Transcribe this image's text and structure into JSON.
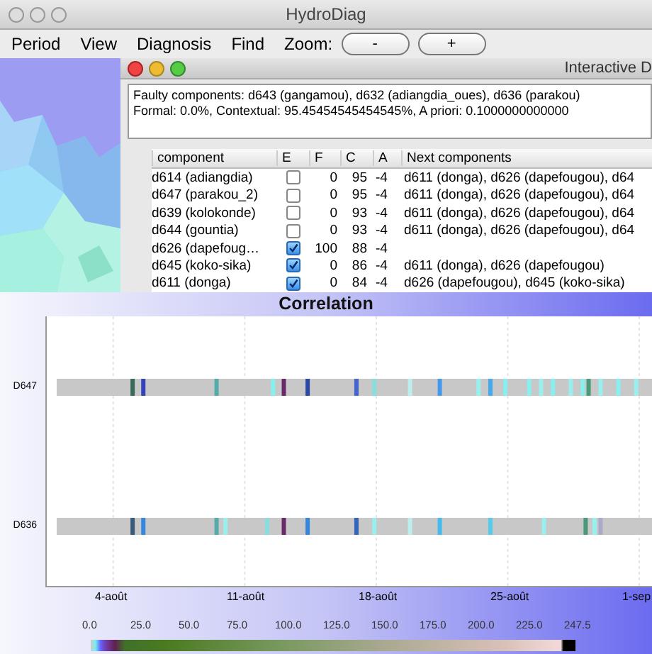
{
  "window": {
    "title": "HydroDiag"
  },
  "menu": [
    "Period",
    "View",
    "Diagnosis",
    "Find"
  ],
  "zoom": {
    "label": "Zoom:",
    "buttons": [
      "-",
      "+"
    ]
  },
  "dialog": {
    "title": "Interactive D",
    "summary": [
      "Faulty components: d643 (gangamou), d632 (adiangdia_oues), d636 (parakou)",
      "Formal: 0.0%, Contextual: 95.45454545454545%, A priori: 0.1000000000000"
    ]
  },
  "table": {
    "columns": [
      "component",
      "E",
      "F",
      "C",
      "A",
      "Next components"
    ],
    "rows": [
      {
        "component": "d614 (adiangdia)",
        "checked": false,
        "f": "0",
        "c": "95",
        "a": "-4",
        "next": "d611 (donga), d626 (dapefougou), d64"
      },
      {
        "component": "d647 (parakou_2)",
        "checked": false,
        "f": "0",
        "c": "95",
        "a": "-4",
        "next": "d611 (donga), d626 (dapefougou), d64"
      },
      {
        "component": "d639 (kolokonde)",
        "checked": false,
        "f": "0",
        "c": "93",
        "a": "-4",
        "next": "d611 (donga), d626 (dapefougou), d64"
      },
      {
        "component": "d644 (gountia)",
        "checked": false,
        "f": "0",
        "c": "93",
        "a": "-4",
        "next": "d611 (donga), d626 (dapefougou), d64"
      },
      {
        "component": "d626 (dapefoug…",
        "checked": true,
        "f": "100",
        "c": "88",
        "a": "-4",
        "next": ""
      },
      {
        "component": "d645 (koko-sika)",
        "checked": true,
        "f": "0",
        "c": "86",
        "a": "-4",
        "next": "d611 (donga), d626 (dapefougou)"
      },
      {
        "component": "d611 (donga)",
        "checked": true,
        "f": "0",
        "c": "84",
        "a": "-4",
        "next": "d626 (dapefougou), d645 (koko-sika)"
      }
    ]
  },
  "correlation": {
    "title": "Correlation",
    "rows": [
      "D647",
      "D636"
    ],
    "xticks": [
      "4-août",
      "11-août",
      "18-août",
      "25-août",
      "1-sep"
    ],
    "legend": [
      "0.0",
      "25.0",
      "50.0",
      "75.0",
      "100.0",
      "125.0",
      "150.0",
      "175.0",
      "200.0",
      "225.0",
      "247.5"
    ]
  }
}
